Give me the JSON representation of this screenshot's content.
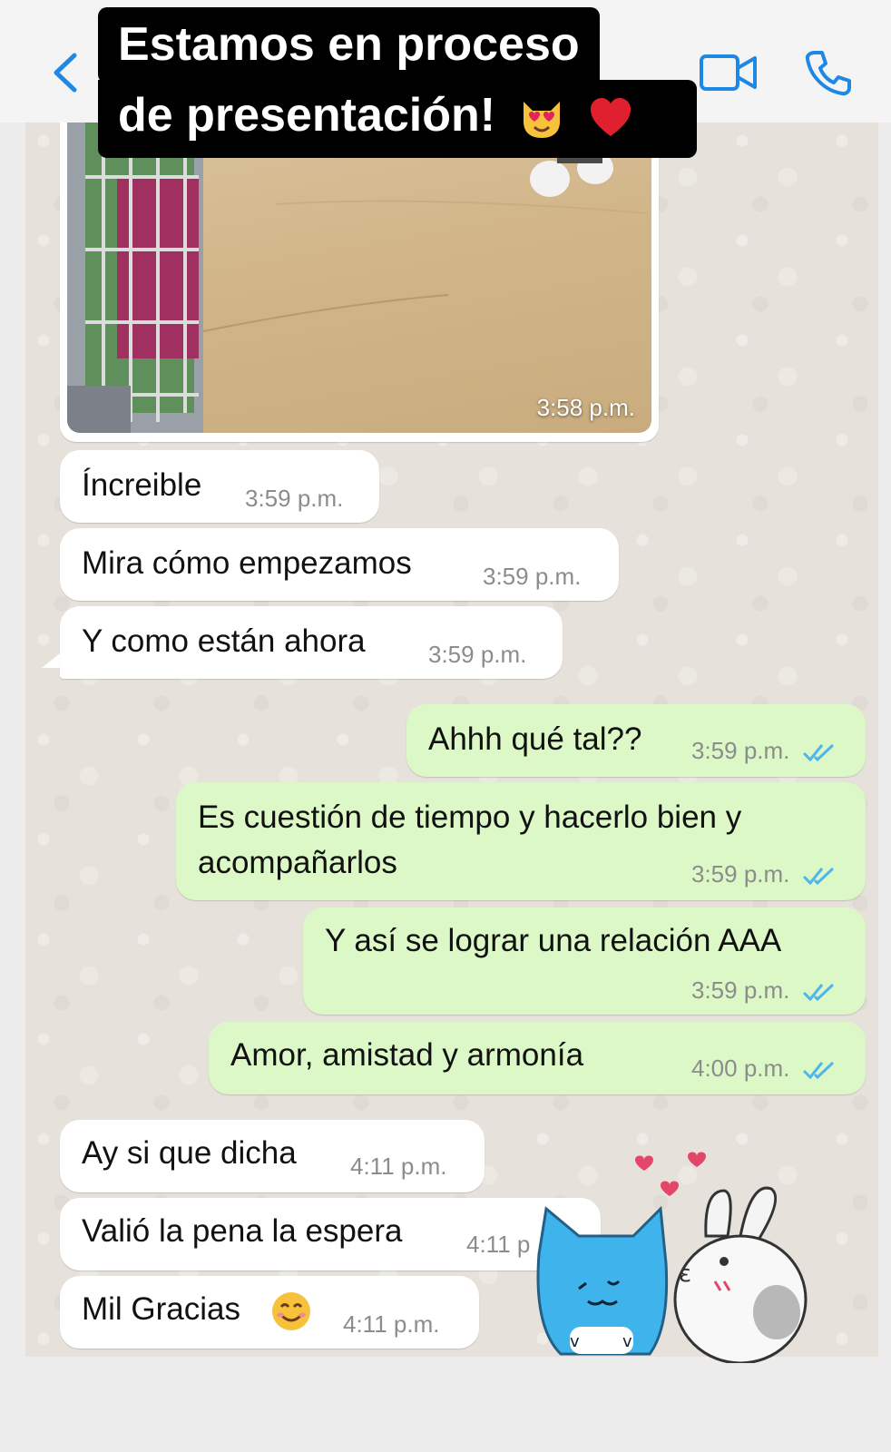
{
  "caption": {
    "line1": "Estamos en  proceso",
    "line2": "de presentación!"
  },
  "header": {
    "back_icon": "chevron-left-icon",
    "video_icon": "video-camera-icon",
    "call_icon": "phone-icon"
  },
  "photo_message": {
    "time": "3:58 p.m."
  },
  "messages": [
    {
      "dir": "in",
      "text": "Íncreible",
      "time": "3:59 p.m."
    },
    {
      "dir": "in",
      "text": "Mira cómo empezamos",
      "time": "3:59 p.m."
    },
    {
      "dir": "in",
      "text": "Y como están ahora",
      "time": "3:59 p.m."
    },
    {
      "dir": "out",
      "text": "Ahhh qué tal??",
      "time": "3:59 p.m."
    },
    {
      "dir": "out",
      "text": "Es cuestión de tiempo y hacerlo bien y acompañarlos",
      "time": "3:59 p.m."
    },
    {
      "dir": "out",
      "text": "Y así se lograr una relación AAA",
      "time": "3:59 p.m."
    },
    {
      "dir": "out",
      "text": "Amor, amistad y armonía",
      "time": "4:00 p.m."
    },
    {
      "dir": "in",
      "text": "Ay si que dicha",
      "time": "4:11 p.m."
    },
    {
      "dir": "in",
      "text": "Valió la pena la espera",
      "time": "4:11 p"
    },
    {
      "dir": "in",
      "text": "Mil Gracias",
      "time": "4:11 p.m."
    }
  ],
  "colors": {
    "incoming": "#ffffff",
    "outgoing": "#dcf8c6",
    "accent": "#1e88e5",
    "read_ticks": "#4fb6ec"
  }
}
